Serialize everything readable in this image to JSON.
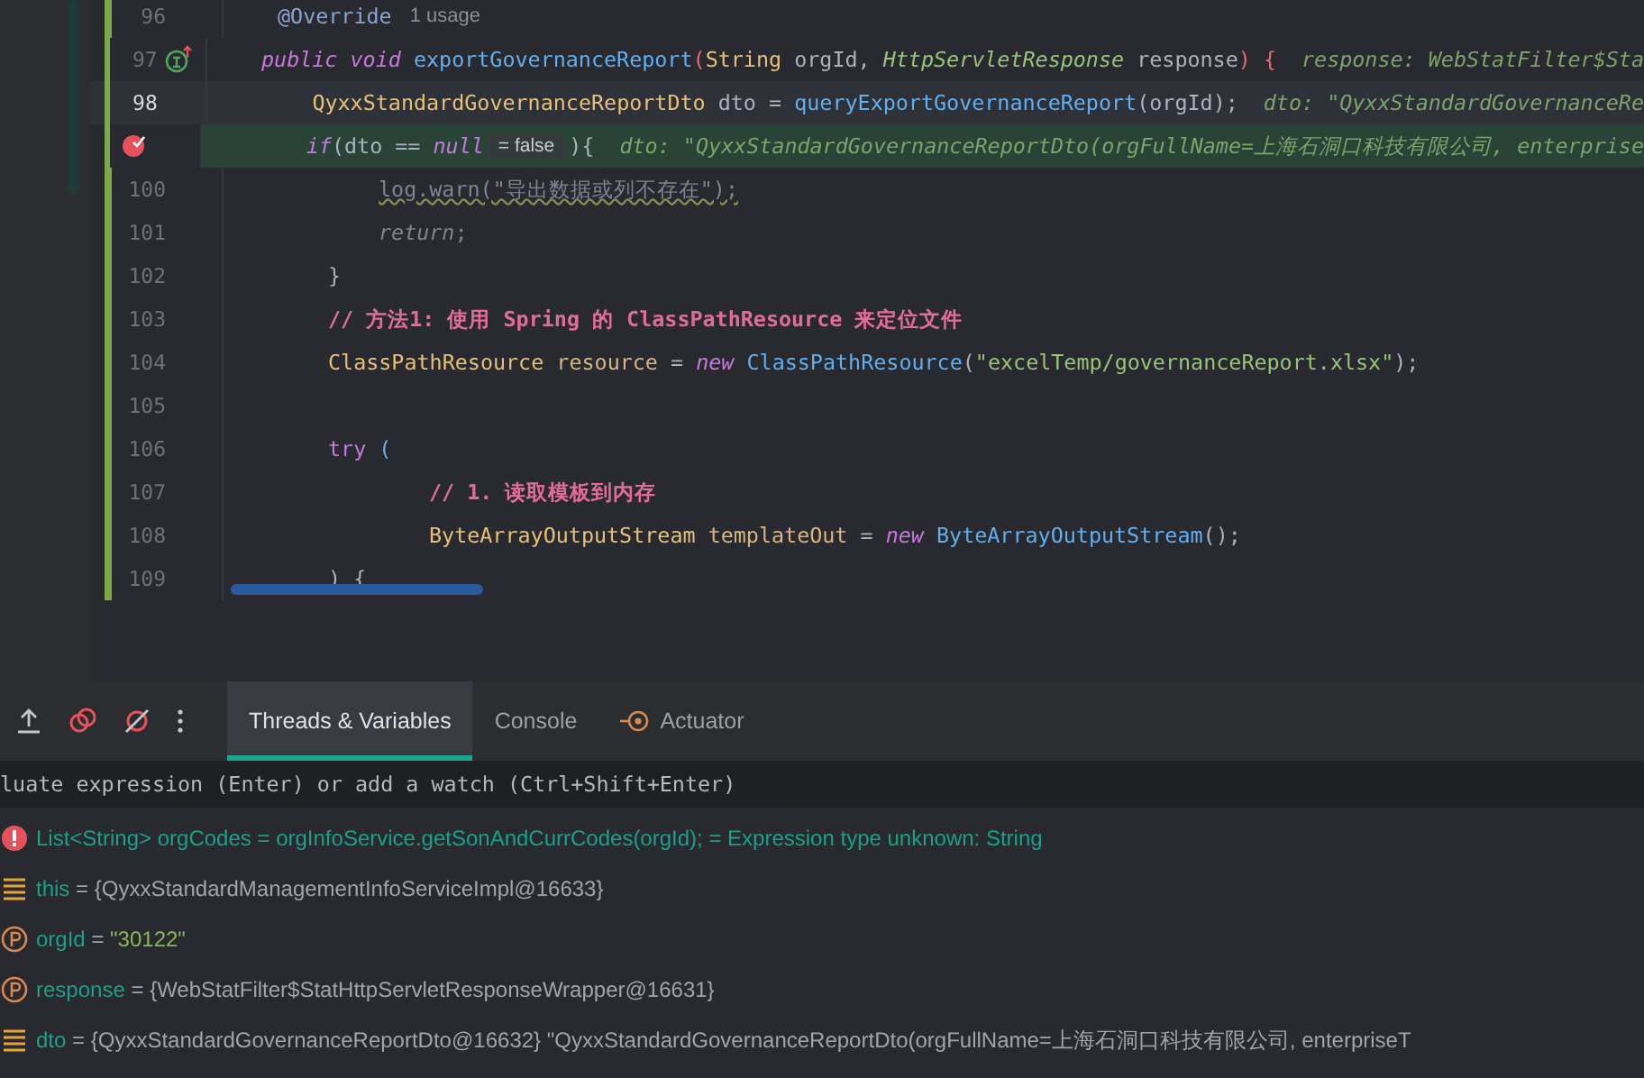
{
  "editor": {
    "lines": [
      {
        "number": "96",
        "current": false,
        "executing": false,
        "tokens": [
          {
            "kind": "annotation",
            "text": "@Override"
          },
          {
            "kind": "usage",
            "text": "1 usage"
          }
        ]
      },
      {
        "number": "97",
        "kind": "implements",
        "current": false,
        "executing": false,
        "tokens": [
          {
            "kind": "keyword",
            "text": "public void "
          },
          {
            "kind": "method",
            "text": "exportGovernanceReport"
          },
          {
            "kind": "brace",
            "text": "("
          },
          {
            "kind": "type",
            "text": "String "
          },
          {
            "kind": "plain",
            "text": "orgId, "
          },
          {
            "kind": "itype",
            "text": "HttpServletResponse "
          },
          {
            "kind": "plain",
            "text": "response"
          },
          {
            "kind": "brace",
            "text": ") {"
          },
          {
            "kind": "hint",
            "text": "response: WebStatFilter$Sta"
          }
        ],
        "children": [
          {
            "number": "98",
            "current": true,
            "executing": false,
            "tokens": [
              {
                "kind": "type",
                "text": "QyxxStandardGovernanceReportDto "
              },
              {
                "kind": "plain",
                "text": "dto = "
              },
              {
                "kind": "method",
                "text": "queryExportGovernanceReport"
              },
              {
                "kind": "plain",
                "text": "(orgId);"
              },
              {
                "kind": "hint",
                "text": "dto: \"QyxxStandardGovernanceRe"
              }
            ]
          },
          {
            "kind": "breakpoint",
            "current": false,
            "executing": true,
            "tokens": [
              {
                "kind": "keyword",
                "text": "if"
              },
              {
                "kind": "plain",
                "text": "(dto == "
              },
              {
                "kind": "keyword",
                "text": "null"
              },
              {
                "kind": "inlay",
                "text": "= false"
              },
              {
                "kind": "plain",
                "text": "){"
              },
              {
                "kind": "hint",
                "text": "dto: \"QyxxStandardGovernanceReportDto(orgFullName=上海石洞口科技有限公司, enterprise"
              }
            ],
            "children": [
              {
                "number": "100",
                "current": false,
                "executing": false,
                "tokens": [
                  {
                    "kind": "warn",
                    "text": "log.warn(\"导出数据或列不存在\");"
                  }
                ]
              },
              {
                "number": "101",
                "current": false,
                "executing": false,
                "tokens": [
                  {
                    "kind": "ital",
                    "text": "return"
                  },
                  {
                    "kind": "grey",
                    "text": ";"
                  }
                ]
              }
            ]
          },
          {
            "number": "102",
            "current": false,
            "executing": false,
            "tokens": [
              {
                "kind": "plain",
                "text": "}"
              }
            ]
          },
          {
            "number": "103",
            "current": false,
            "executing": false,
            "tokens": [
              {
                "kind": "comment",
                "text": "// 方法1: 使用 Spring 的 ClassPathResource 来定位文件"
              }
            ]
          },
          {
            "number": "104",
            "current": false,
            "executing": false,
            "tokens": [
              {
                "kind": "type",
                "text": "ClassPathResource "
              },
              {
                "kind": "var",
                "text": "resource "
              },
              {
                "kind": "plain",
                "text": "= "
              },
              {
                "kind": "keyword",
                "text": "new "
              },
              {
                "kind": "method",
                "text": "ClassPathResource"
              },
              {
                "kind": "plain",
                "text": "("
              },
              {
                "kind": "string",
                "text": "\"excelTemp/governanceReport.xlsx\""
              },
              {
                "kind": "plain",
                "text": ");"
              }
            ]
          },
          {
            "number": "105",
            "current": false,
            "executing": false
          },
          {
            "number": "106",
            "current": false,
            "executing": false,
            "tokens": [
              {
                "kind": "keywordplain",
                "text": "try "
              },
              {
                "kind": "method",
                "text": "("
              }
            ],
            "children": [
              {
                "number": "107",
                "current": false,
                "executing": false,
                "tokens": [
                  {
                    "kind": "comment",
                    "text": "// 1. 读取模板到内存"
                  }
                ]
              },
              {
                "number": "108",
                "current": false,
                "executing": false,
                "tokens": [
                  {
                    "kind": "type",
                    "text": "ByteArrayOutputStream "
                  },
                  {
                    "kind": "var",
                    "text": "templateOut "
                  },
                  {
                    "kind": "plain",
                    "text": "= "
                  },
                  {
                    "kind": "keyword",
                    "text": "new "
                  },
                  {
                    "kind": "method",
                    "text": "ByteArrayOutputStream"
                  },
                  {
                    "kind": "plain",
                    "text": "();"
                  }
                ]
              }
            ]
          },
          {
            "number": "109",
            "current": false,
            "executing": false,
            "tokens": [
              {
                "kind": "plain",
                "text": ") {"
              }
            ]
          }
        ]
      }
    ]
  },
  "debug": {
    "tabs": [
      {
        "label": "Threads & Variables",
        "selected": true
      },
      {
        "label": "Console",
        "selected": false
      },
      {
        "label": "Actuator",
        "selected": false,
        "kind": "actuator"
      }
    ],
    "evaluate": {
      "placeholder": "luate expression (Enter) or add a watch (Ctrl+Shift+Enter)"
    },
    "variables": [
      {
        "kind": "error",
        "parts": [
          {
            "kind": "name",
            "text": "List<String> orgCodes = orgInfoService.getSonAndCurrCodes(orgId); = Expression type unknown: String"
          }
        ]
      },
      {
        "kind": "field",
        "parts": [
          {
            "kind": "name",
            "text": "this"
          },
          {
            "kind": "eq",
            "text": " = "
          },
          {
            "kind": "value",
            "text": "{QyxxStandardManagementInfoServiceImpl@16633}"
          }
        ]
      },
      {
        "kind": "param",
        "parts": [
          {
            "kind": "name",
            "text": "orgId"
          },
          {
            "kind": "eq",
            "text": " = "
          },
          {
            "kind": "string",
            "text": "\"30122\""
          }
        ]
      },
      {
        "kind": "param",
        "parts": [
          {
            "kind": "name",
            "text": "response"
          },
          {
            "kind": "eq",
            "text": " = "
          },
          {
            "kind": "value",
            "text": "{WebStatFilter$StatHttpServletResponseWrapper@16631}"
          }
        ]
      },
      {
        "kind": "field",
        "parts": [
          {
            "kind": "name",
            "text": "dto"
          },
          {
            "kind": "eq",
            "text": " = "
          },
          {
            "kind": "value",
            "text": "{QyxxStandardGovernanceReportDto@16632} \"QyxxStandardGovernanceReportDto(orgFullName=上海石洞口科技有限公司, enterpriseT"
          }
        ]
      }
    ]
  }
}
